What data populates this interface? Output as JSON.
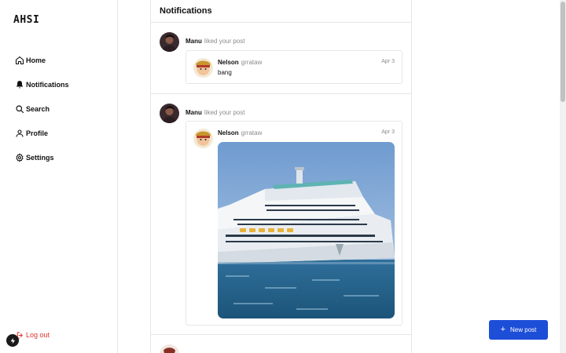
{
  "app": {
    "logo": "AHSI"
  },
  "sidebar": {
    "items": [
      {
        "label": "Home",
        "icon": "home-icon"
      },
      {
        "label": "Notifications",
        "icon": "bell-icon"
      },
      {
        "label": "Search",
        "icon": "search-icon"
      },
      {
        "label": "Profile",
        "icon": "user-icon"
      },
      {
        "label": "Settings",
        "icon": "gear-icon"
      }
    ],
    "logout_label": "Log out",
    "logout_color": "#e0342f"
  },
  "main": {
    "title": "Notifications",
    "notifications": [
      {
        "actor": "Manu",
        "action": "liked your post",
        "post": {
          "author": "Nelson",
          "handle": "grrataw",
          "date": "Apr 3",
          "text": "bang"
        }
      },
      {
        "actor": "Manu",
        "action": "liked your post",
        "post": {
          "author": "Nelson",
          "handle": "grrataw",
          "date": "Apr 3",
          "image": "cruise-ship-photo"
        }
      }
    ]
  },
  "new_post": {
    "label": "New post",
    "color": "#1d4ed8"
  }
}
